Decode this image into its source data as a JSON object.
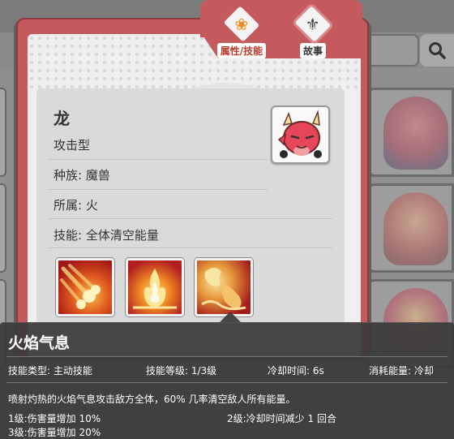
{
  "tabs": {
    "attributes_label": "属性/技能",
    "story_label": "故事"
  },
  "hero": {
    "name": "龙",
    "type": "攻击型",
    "race": "种族: 魔兽",
    "affiliation": "所属: 火",
    "skill_summary": "技能: 全体清空能量"
  },
  "skills": [
    {
      "icon": "flaming-meteors-icon"
    },
    {
      "icon": "fire-burst-icon"
    },
    {
      "icon": "dragon-fire-breath-icon"
    }
  ],
  "tooltip": {
    "title": "火焰气息",
    "skill_type": "技能类型: 主动技能",
    "skill_level": "技能等级: 1/3级",
    "cooldown": "冷却时间: 6s",
    "energy_cost": "消耗能量: 冷却",
    "description": "喷射灼热的火焰气息攻击敌方全体，60% 几率清空敌人所有能量。",
    "level_1": "1级:伤害量增加 10%",
    "level_2": "2级:冷却时间减少 1 回合",
    "level_3": "3级:伤害量增加 20%"
  },
  "colors": {
    "card_frame": "#c55a5e",
    "active_tab_icon": "#f08a18",
    "tooltip_bg": "#3a3a3a"
  }
}
